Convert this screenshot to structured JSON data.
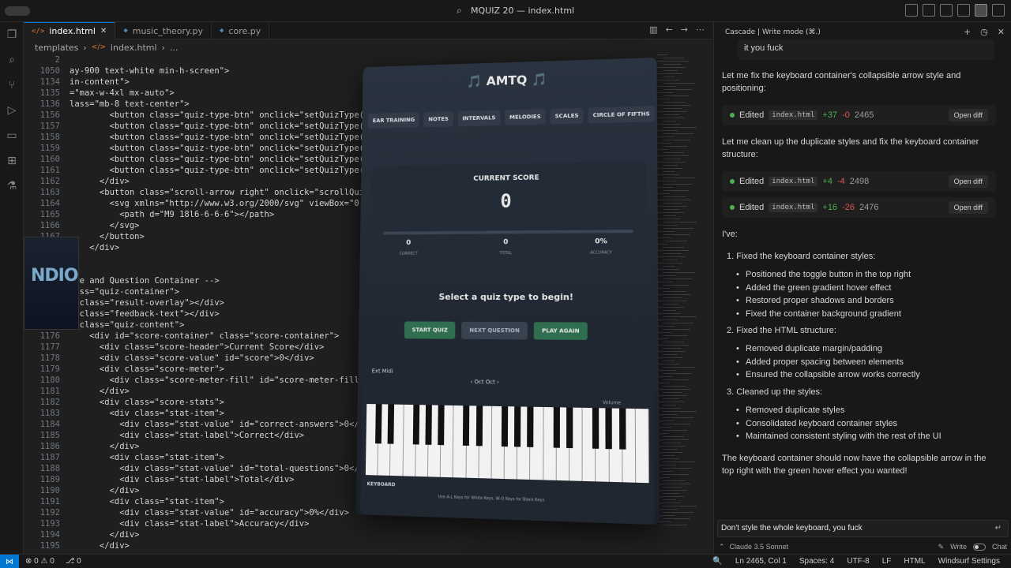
{
  "window": {
    "title": "MQUIZ 20 — index.html"
  },
  "tabs": [
    {
      "label": "index.html",
      "icon": "html-icon"
    },
    {
      "label": "music_theory.py",
      "icon": "python-icon"
    },
    {
      "label": "core.py",
      "icon": "python-icon"
    }
  ],
  "breadcrumb": {
    "folder": "templates",
    "file": "index.html",
    "more": "..."
  },
  "code_lines": [
    {
      "n": "2",
      "t": ""
    },
    {
      "n": "1050",
      "t": "ay-900 text-white min-h-screen\">"
    },
    {
      "n": "1134",
      "t": "in-content\">"
    },
    {
      "n": "1135",
      "t": "=\"max-w-4xl mx-auto\">"
    },
    {
      "n": "1136",
      "t": "lass=\"mb-8 text-center\">"
    },
    {
      "n": "1156",
      "t": "        <button class=\"quiz-type-btn\" onclick=\"setQuizType('CHORDS'"
    },
    {
      "n": "1157",
      "t": "        <button class=\"quiz-type-btn\" onclick=\"setQuizType('PROGRES"
    },
    {
      "n": "1158",
      "t": "        <button class=\"quiz-type-btn\" onclick=\"setQuizType('RHYTHM'"
    },
    {
      "n": "1159",
      "t": "        <button class=\"quiz-type-btn\" onclick=\"setQuizType('MODES')"
    },
    {
      "n": "1160",
      "t": "        <button class=\"quiz-type-btn\" onclick=\"setQuizType('CADENCES"
    },
    {
      "n": "1161",
      "t": "        <button class=\"quiz-type-btn\" onclick=\"setQuizType('KEY-SIGN"
    },
    {
      "n": "1162",
      "t": "      </div>"
    },
    {
      "n": "1163",
      "t": "      <button class=\"scroll-arrow right\" onclick=\"scrollQuizButtons('r"
    },
    {
      "n": "1164",
      "t": "        <svg xmlns=\"http://www.w3.org/2000/svg\" viewBox=\"0 0 24 24\""
    },
    {
      "n": "1165",
      "t": "          <path d=\"M9 18l6-6-6-6\"></path>"
    },
    {
      "n": "1166",
      "t": "        </svg>"
    },
    {
      "n": "1167",
      "t": "      </button>"
    },
    {
      "n": "1168",
      "t": "    </div>"
    },
    {
      "n": "1169",
      "t": ""
    },
    {
      "n": "1170",
      "t": ""
    },
    {
      "n": "1171",
      "t": "ore and Question Container -->"
    },
    {
      "n": "1172",
      "t": "lass=\"quiz-container\">"
    },
    {
      "n": "1173",
      "t": "v class=\"result-overlay\"></div>"
    },
    {
      "n": "1174",
      "t": "v class=\"feedback-text\"></div>"
    },
    {
      "n": "1175",
      "t": "v class=\"quiz-content\">"
    },
    {
      "n": "1176",
      "t": "    <div id=\"score-container\" class=\"score-container\">"
    },
    {
      "n": "1177",
      "t": "      <div class=\"score-header\">Current Score</div>"
    },
    {
      "n": "1178",
      "t": "      <div class=\"score-value\" id=\"score\">0</div>"
    },
    {
      "n": "1179",
      "t": "      <div class=\"score-meter\">"
    },
    {
      "n": "1180",
      "t": "        <div class=\"score-meter-fill\" id=\"score-meter-fill\" styl"
    },
    {
      "n": "1181",
      "t": "      </div>"
    },
    {
      "n": "1182",
      "t": "      <div class=\"score-stats\">"
    },
    {
      "n": "1183",
      "t": "        <div class=\"stat-item\">"
    },
    {
      "n": "1184",
      "t": "          <div class=\"stat-value\" id=\"correct-answers\">0</div>"
    },
    {
      "n": "1185",
      "t": "          <div class=\"stat-label\">Correct</div>"
    },
    {
      "n": "1186",
      "t": "        </div>"
    },
    {
      "n": "1187",
      "t": "        <div class=\"stat-item\">"
    },
    {
      "n": "1188",
      "t": "          <div class=\"stat-value\" id=\"total-questions\">0</div>"
    },
    {
      "n": "1189",
      "t": "          <div class=\"stat-label\">Total</div>"
    },
    {
      "n": "1190",
      "t": "        </div>"
    },
    {
      "n": "1191",
      "t": "        <div class=\"stat-item\">"
    },
    {
      "n": "1192",
      "t": "          <div class=\"stat-value\" id=\"accuracy\">0%</div>"
    },
    {
      "n": "1193",
      "t": "          <div class=\"stat-label\">Accuracy</div>"
    },
    {
      "n": "1194",
      "t": "        </div>"
    },
    {
      "n": "1195",
      "t": "      </div>"
    }
  ],
  "preview": {
    "title": "🎵 AMTQ 🎵",
    "tabs": [
      "EAR TRAINING",
      "NOTES",
      "INTERVALS",
      "MELODIES",
      "SCALES",
      "CIRCLE OF FIFTHS"
    ],
    "score_header": "CURRENT SCORE",
    "score_value": "0",
    "stats": [
      {
        "value": "0",
        "label": "CORRECT"
      },
      {
        "value": "0",
        "label": "TOTAL"
      },
      {
        "value": "0%",
        "label": "ACCURACY"
      }
    ],
    "prompt": "Select a quiz type to begin!",
    "buttons": [
      "START QUIZ",
      "NEXT QUESTION",
      "PLAY AGAIN"
    ],
    "midi_label": "Ext Midi",
    "octave_label": "‹ Oct  Oct ›",
    "volume_label": "Volume",
    "keyboard_label": "KEYBOARD",
    "hint": "Use A-L Keys for White Keys, W-O Keys for Black Keys"
  },
  "cam_logo": "NDIO",
  "panel": {
    "header": "Cascade | Write mode (⌘.)",
    "user_msg_1": "it you fuck",
    "msg_1": "Let me fix the keyboard container's collapsible arrow style and positioning:",
    "edit_1": {
      "label": "Edited",
      "file": "index.html",
      "plus": "+37",
      "minus": "-0",
      "num": "2465",
      "action": "Open diff"
    },
    "msg_2": "Let me clean up the duplicate styles and fix the keyboard container structure:",
    "edit_2": {
      "label": "Edited",
      "file": "index.html",
      "plus": "+4",
      "minus": "-4",
      "num": "2498",
      "action": "Open diff"
    },
    "edit_3": {
      "label": "Edited",
      "file": "index.html",
      "plus": "+16",
      "minus": "-26",
      "num": "2476",
      "action": "Open diff"
    },
    "summary_intro": "I've:",
    "sections": [
      {
        "title": "1.  Fixed the keyboard container styles:",
        "items": [
          "Positioned the toggle button in the top right",
          "Added the green gradient hover effect",
          "Restored proper shadows and borders",
          "Fixed the container background gradient"
        ]
      },
      {
        "title": "2.  Fixed the HTML structure:",
        "items": [
          "Removed duplicate margin/padding",
          "Added proper spacing between elements",
          "Ensured the collapsible arrow works correctly"
        ]
      },
      {
        "title": "3.  Cleaned up the styles:",
        "items": [
          "Removed duplicate styles",
          "Consolidated keyboard container styles",
          "Maintained consistent styling with the rest of the UI"
        ]
      }
    ],
    "closing": "The keyboard container should now have the collapsible arrow in the top right with the green hover effect you wanted!",
    "input_value": "Don't style the whole keyboard, you fuck",
    "model": "Claude 3.5 Sonnet",
    "mode_write": "Write",
    "mode_chat": "Chat"
  },
  "status": {
    "errors": "⊗ 0  ⚠ 0",
    "ports": "⎇ 0",
    "position": "Ln 2465, Col 1",
    "spaces": "Spaces: 4",
    "encoding": "UTF-8",
    "eol": "LF",
    "language": "HTML",
    "settings": "Windsurf Settings"
  }
}
